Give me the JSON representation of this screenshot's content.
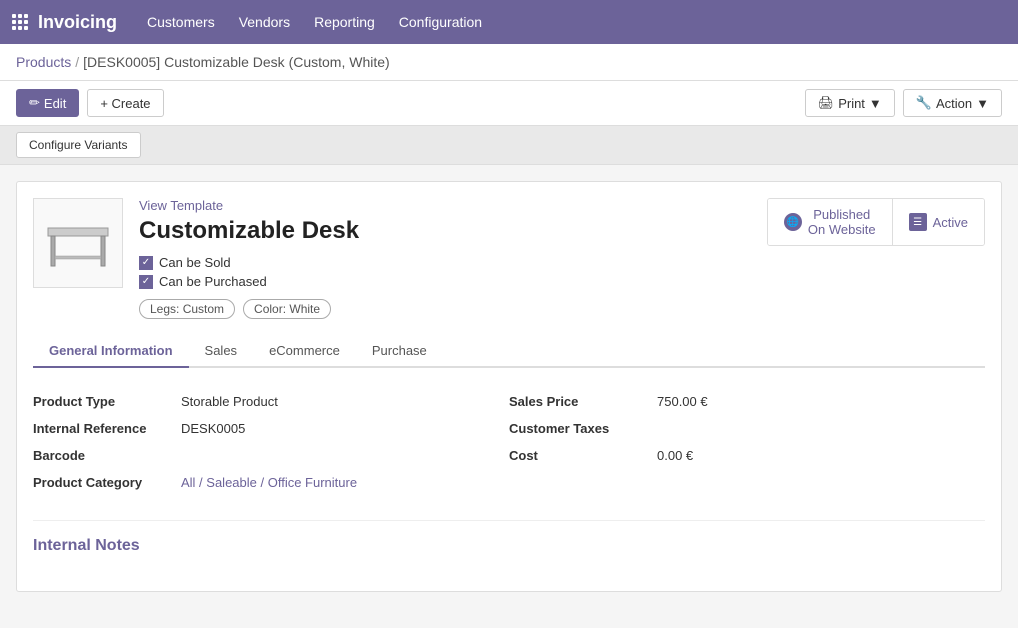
{
  "navbar": {
    "app_icon": "grid-icon",
    "app_name": "Invoicing",
    "menu_items": [
      {
        "label": "Customers",
        "id": "customers"
      },
      {
        "label": "Vendors",
        "id": "vendors"
      },
      {
        "label": "Reporting",
        "id": "reporting"
      },
      {
        "label": "Configuration",
        "id": "configuration"
      }
    ]
  },
  "breadcrumb": {
    "parent_label": "Products",
    "separator": "/",
    "current_label": "[DESK0005] Customizable Desk (Custom, White)"
  },
  "toolbar": {
    "edit_label": "Edit",
    "create_label": "+ Create",
    "print_label": "Print",
    "action_label": "Action"
  },
  "sub_toolbar": {
    "configure_variants_label": "Configure Variants"
  },
  "product": {
    "view_template_label": "View Template",
    "name": "Customizable Desk",
    "can_be_sold_label": "Can be Sold",
    "can_be_purchased_label": "Can be Purchased",
    "variant_tags": [
      {
        "label": "Legs: Custom"
      },
      {
        "label": "Color: White"
      }
    ],
    "status": {
      "published_label": "Published\nOn Website",
      "active_label": "Active"
    }
  },
  "tabs": [
    {
      "label": "General Information",
      "id": "general",
      "active": true
    },
    {
      "label": "Sales",
      "id": "sales",
      "active": false
    },
    {
      "label": "eCommerce",
      "id": "ecommerce",
      "active": false
    },
    {
      "label": "Purchase",
      "id": "purchase",
      "active": false
    }
  ],
  "general_info": {
    "left_fields": [
      {
        "label": "Product Type",
        "value": "Storable Product",
        "is_link": false
      },
      {
        "label": "Internal Reference",
        "value": "DESK0005",
        "is_link": false
      },
      {
        "label": "Barcode",
        "value": "",
        "is_link": false
      },
      {
        "label": "Product Category",
        "value": "All / Saleable / Office Furniture",
        "is_link": true
      }
    ],
    "right_fields": [
      {
        "label": "Sales Price",
        "value": "750.00 €",
        "is_link": false
      },
      {
        "label": "Customer Taxes",
        "value": "",
        "is_link": false
      },
      {
        "label": "Cost",
        "value": "0.00 €",
        "is_link": false
      }
    ]
  },
  "internal_notes": {
    "title": "Internal Notes"
  }
}
